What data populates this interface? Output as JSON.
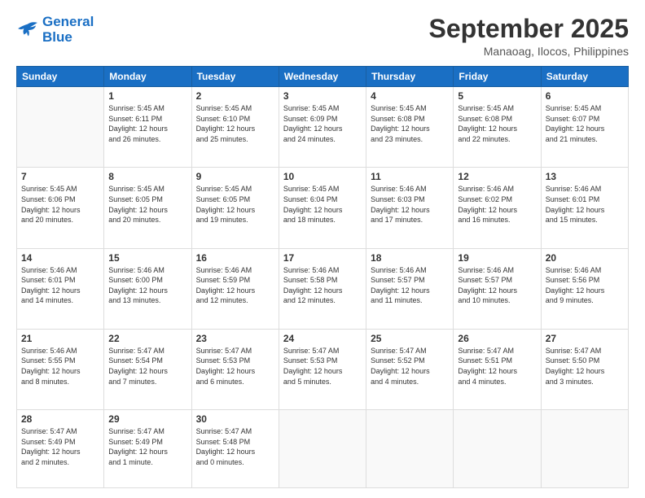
{
  "logo": {
    "line1": "General",
    "line2": "Blue"
  },
  "title": "September 2025",
  "subtitle": "Manaoag, Ilocos, Philippines",
  "days": [
    "Sunday",
    "Monday",
    "Tuesday",
    "Wednesday",
    "Thursday",
    "Friday",
    "Saturday"
  ],
  "weeks": [
    [
      {
        "day": "",
        "content": ""
      },
      {
        "day": "1",
        "content": "Sunrise: 5:45 AM\nSunset: 6:11 PM\nDaylight: 12 hours\nand 26 minutes."
      },
      {
        "day": "2",
        "content": "Sunrise: 5:45 AM\nSunset: 6:10 PM\nDaylight: 12 hours\nand 25 minutes."
      },
      {
        "day": "3",
        "content": "Sunrise: 5:45 AM\nSunset: 6:09 PM\nDaylight: 12 hours\nand 24 minutes."
      },
      {
        "day": "4",
        "content": "Sunrise: 5:45 AM\nSunset: 6:08 PM\nDaylight: 12 hours\nand 23 minutes."
      },
      {
        "day": "5",
        "content": "Sunrise: 5:45 AM\nSunset: 6:08 PM\nDaylight: 12 hours\nand 22 minutes."
      },
      {
        "day": "6",
        "content": "Sunrise: 5:45 AM\nSunset: 6:07 PM\nDaylight: 12 hours\nand 21 minutes."
      }
    ],
    [
      {
        "day": "7",
        "content": "Sunrise: 5:45 AM\nSunset: 6:06 PM\nDaylight: 12 hours\nand 20 minutes."
      },
      {
        "day": "8",
        "content": "Sunrise: 5:45 AM\nSunset: 6:05 PM\nDaylight: 12 hours\nand 20 minutes."
      },
      {
        "day": "9",
        "content": "Sunrise: 5:45 AM\nSunset: 6:05 PM\nDaylight: 12 hours\nand 19 minutes."
      },
      {
        "day": "10",
        "content": "Sunrise: 5:45 AM\nSunset: 6:04 PM\nDaylight: 12 hours\nand 18 minutes."
      },
      {
        "day": "11",
        "content": "Sunrise: 5:46 AM\nSunset: 6:03 PM\nDaylight: 12 hours\nand 17 minutes."
      },
      {
        "day": "12",
        "content": "Sunrise: 5:46 AM\nSunset: 6:02 PM\nDaylight: 12 hours\nand 16 minutes."
      },
      {
        "day": "13",
        "content": "Sunrise: 5:46 AM\nSunset: 6:01 PM\nDaylight: 12 hours\nand 15 minutes."
      }
    ],
    [
      {
        "day": "14",
        "content": "Sunrise: 5:46 AM\nSunset: 6:01 PM\nDaylight: 12 hours\nand 14 minutes."
      },
      {
        "day": "15",
        "content": "Sunrise: 5:46 AM\nSunset: 6:00 PM\nDaylight: 12 hours\nand 13 minutes."
      },
      {
        "day": "16",
        "content": "Sunrise: 5:46 AM\nSunset: 5:59 PM\nDaylight: 12 hours\nand 12 minutes."
      },
      {
        "day": "17",
        "content": "Sunrise: 5:46 AM\nSunset: 5:58 PM\nDaylight: 12 hours\nand 12 minutes."
      },
      {
        "day": "18",
        "content": "Sunrise: 5:46 AM\nSunset: 5:57 PM\nDaylight: 12 hours\nand 11 minutes."
      },
      {
        "day": "19",
        "content": "Sunrise: 5:46 AM\nSunset: 5:57 PM\nDaylight: 12 hours\nand 10 minutes."
      },
      {
        "day": "20",
        "content": "Sunrise: 5:46 AM\nSunset: 5:56 PM\nDaylight: 12 hours\nand 9 minutes."
      }
    ],
    [
      {
        "day": "21",
        "content": "Sunrise: 5:46 AM\nSunset: 5:55 PM\nDaylight: 12 hours\nand 8 minutes."
      },
      {
        "day": "22",
        "content": "Sunrise: 5:47 AM\nSunset: 5:54 PM\nDaylight: 12 hours\nand 7 minutes."
      },
      {
        "day": "23",
        "content": "Sunrise: 5:47 AM\nSunset: 5:53 PM\nDaylight: 12 hours\nand 6 minutes."
      },
      {
        "day": "24",
        "content": "Sunrise: 5:47 AM\nSunset: 5:53 PM\nDaylight: 12 hours\nand 5 minutes."
      },
      {
        "day": "25",
        "content": "Sunrise: 5:47 AM\nSunset: 5:52 PM\nDaylight: 12 hours\nand 4 minutes."
      },
      {
        "day": "26",
        "content": "Sunrise: 5:47 AM\nSunset: 5:51 PM\nDaylight: 12 hours\nand 4 minutes."
      },
      {
        "day": "27",
        "content": "Sunrise: 5:47 AM\nSunset: 5:50 PM\nDaylight: 12 hours\nand 3 minutes."
      }
    ],
    [
      {
        "day": "28",
        "content": "Sunrise: 5:47 AM\nSunset: 5:49 PM\nDaylight: 12 hours\nand 2 minutes."
      },
      {
        "day": "29",
        "content": "Sunrise: 5:47 AM\nSunset: 5:49 PM\nDaylight: 12 hours\nand 1 minute."
      },
      {
        "day": "30",
        "content": "Sunrise: 5:47 AM\nSunset: 5:48 PM\nDaylight: 12 hours\nand 0 minutes."
      },
      {
        "day": "",
        "content": ""
      },
      {
        "day": "",
        "content": ""
      },
      {
        "day": "",
        "content": ""
      },
      {
        "day": "",
        "content": ""
      }
    ]
  ]
}
